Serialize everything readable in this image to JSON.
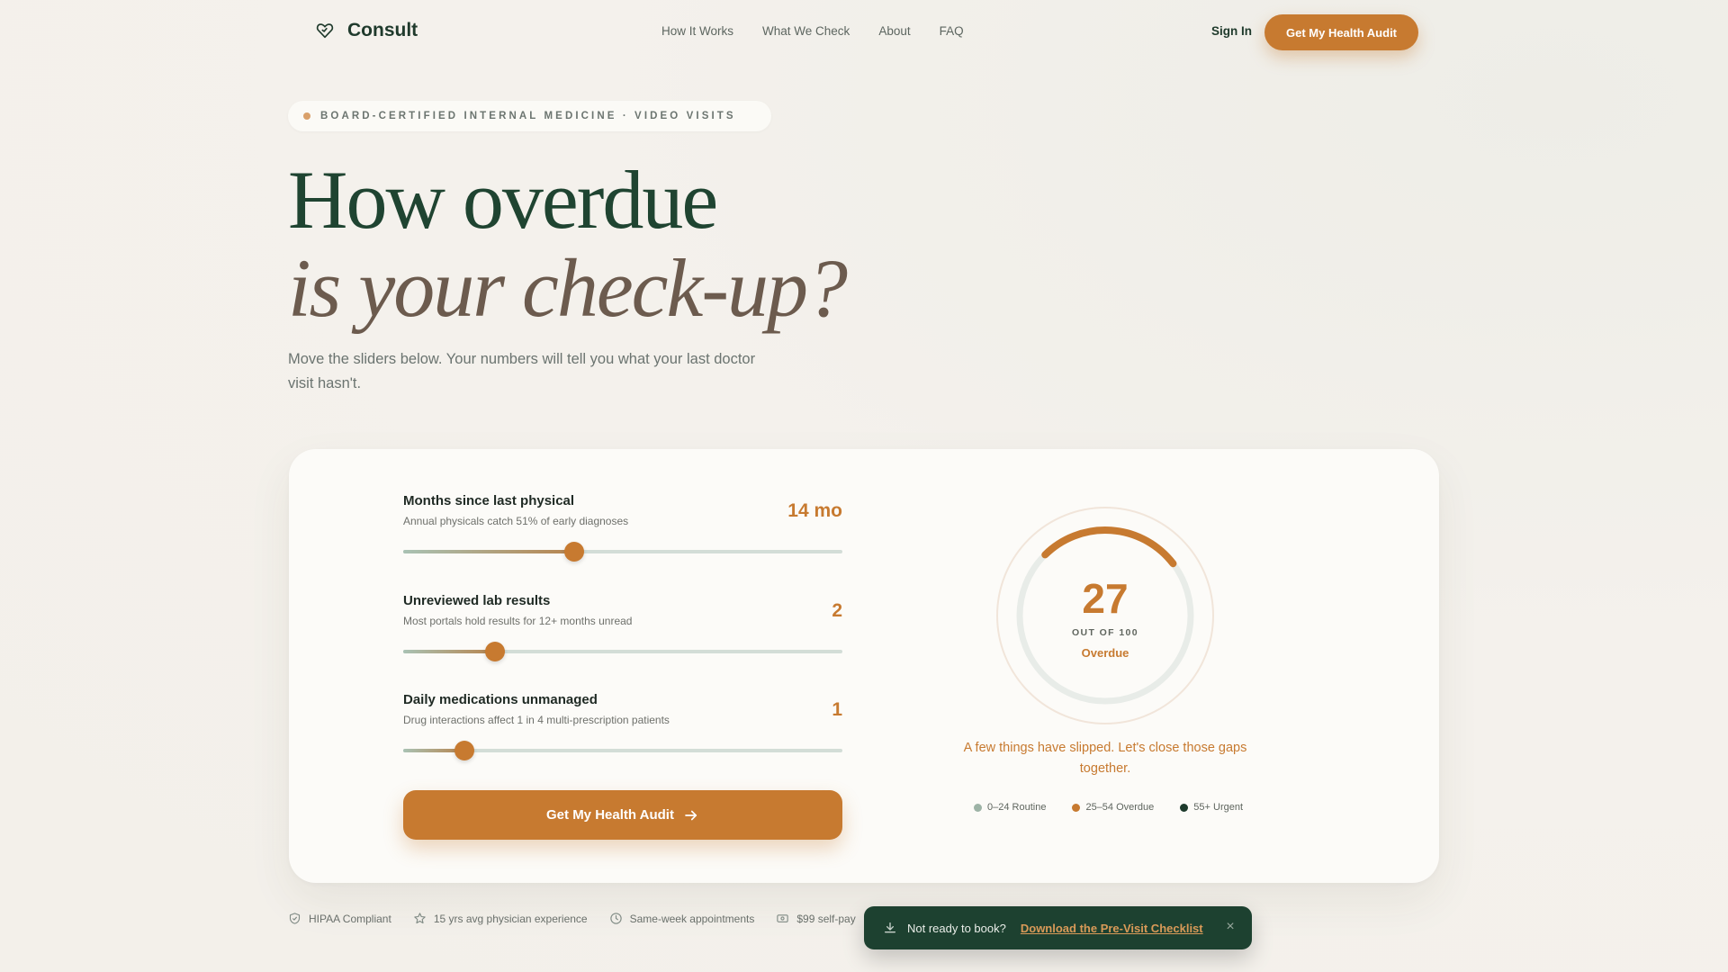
{
  "nav": {
    "brand": "Consult",
    "links": [
      "How It Works",
      "What We Check",
      "About",
      "FAQ"
    ],
    "sign_in": "Sign In",
    "cta": "Get My Health Audit"
  },
  "hero": {
    "badge": "BOARD-CERTIFIED INTERNAL MEDICINE · VIDEO VISITS",
    "headline_line1": "How overdue",
    "headline_line2": "is your check-up?",
    "subtitle": "Move the sliders below. Your numbers will tell you what your last doctor visit hasn't."
  },
  "calculator": {
    "sliders": [
      {
        "title": "Months since last physical",
        "description": "Annual physicals catch 51% of early diagnoses",
        "value_label": "14 mo",
        "level": 0.39
      },
      {
        "title": "Unreviewed lab results",
        "description": "Most portals hold results for 12+ months unread",
        "value_label": "2",
        "level": 0.21
      },
      {
        "title": "Daily medications unmanaged",
        "description": "Drug interactions affect 1 in 4 multi-prescription patients",
        "value_label": "1",
        "level": 0.14
      }
    ],
    "cta": "Get My Health Audit",
    "score": {
      "value": "27",
      "max": 100,
      "out_of_label": "OUT OF 100",
      "status": "Overdue",
      "message": "A few things have slipped. Let's close those gaps together.",
      "legend": [
        {
          "label": "0–24 Routine",
          "color": "#9db3a6"
        },
        {
          "label": "25–54 Overdue",
          "color": "#c77a30"
        },
        {
          "label": "55+ Urgent",
          "color": "#1d3a2c"
        }
      ]
    }
  },
  "trust": [
    {
      "icon": "shield-check-icon",
      "label": "HIPAA Compliant"
    },
    {
      "icon": "star-icon",
      "label": "15 yrs avg physician experience"
    },
    {
      "icon": "clock-icon",
      "label": "Same-week appointments"
    },
    {
      "icon": "cash-icon",
      "label": "$99 self-pay"
    }
  ],
  "toast": {
    "text": "Not ready to book?",
    "link": "Download the Pre-Visit Checklist",
    "close": "×"
  },
  "colors": {
    "accent": "#c77a30",
    "brand_green": "#1f4431",
    "toast_bg": "#1d4130"
  }
}
